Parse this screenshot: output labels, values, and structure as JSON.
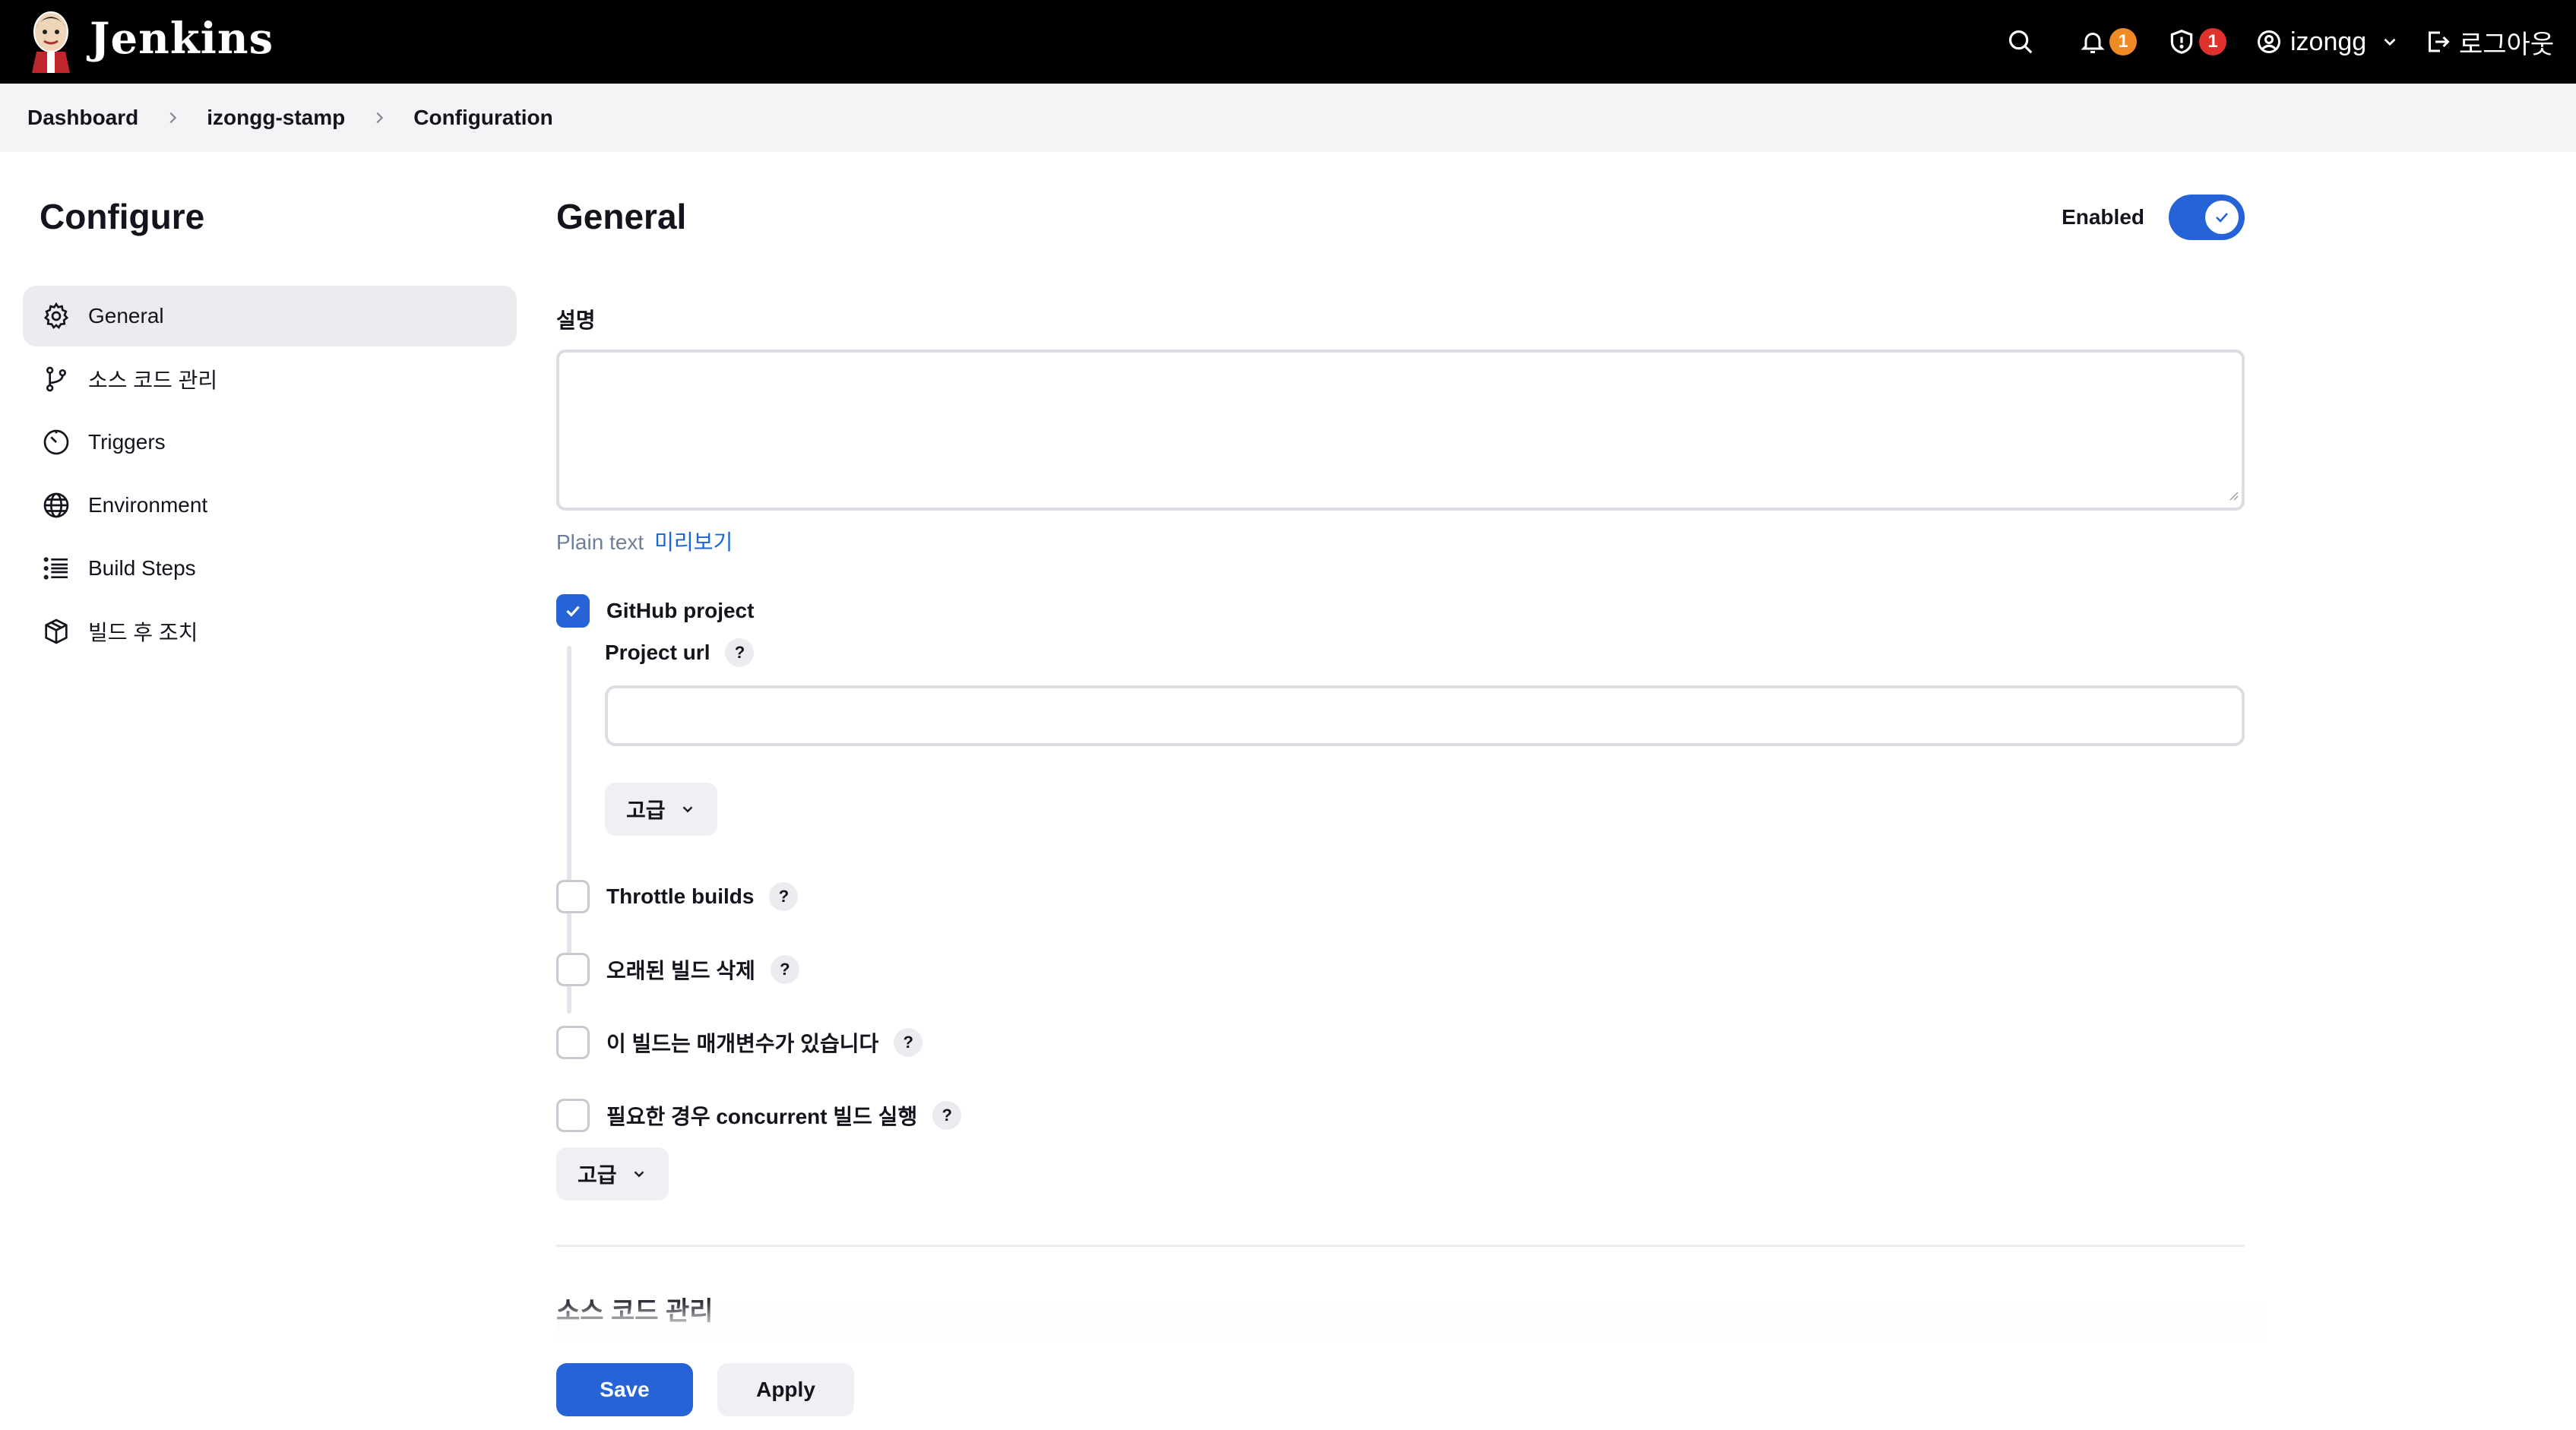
{
  "header": {
    "brand": "Jenkins",
    "notifications_count": "1",
    "security_count": "1",
    "username": "izongg",
    "logout_label": "로그아웃",
    "colors": {
      "background": "#000000",
      "notif_badge": "#f08a24",
      "security_badge": "#e0322d"
    }
  },
  "breadcrumb": {
    "items": [
      "Dashboard",
      "izongg-stamp",
      "Configuration"
    ]
  },
  "sidebar": {
    "title": "Configure",
    "items": [
      {
        "label": "General",
        "icon": "gear-icon",
        "active": true
      },
      {
        "label": "소스 코드 관리",
        "icon": "git-branch-icon"
      },
      {
        "label": "Triggers",
        "icon": "timer-icon"
      },
      {
        "label": "Environment",
        "icon": "globe-icon"
      },
      {
        "label": "Build Steps",
        "icon": "list-icon"
      },
      {
        "label": "빌드 후 조치",
        "icon": "package-icon"
      }
    ]
  },
  "general": {
    "title": "General",
    "enabled_label": "Enabled",
    "enabled": true,
    "description_label": "설명",
    "description_value": "",
    "plain_text": "Plain text",
    "preview": "미리보기",
    "github_project_label": "GitHub project",
    "github_project_checked": true,
    "project_url_label": "Project url",
    "project_url_value": "",
    "advanced_label": "고급",
    "options": [
      {
        "label": "Throttle builds",
        "checked": false
      },
      {
        "label": "오래된 빌드 삭제",
        "checked": false
      },
      {
        "label": "이 빌드는 매개변수가 있습니다",
        "checked": false
      },
      {
        "label": "필요한 경우 concurrent 빌드 실행",
        "checked": false
      }
    ],
    "help_symbol": "?"
  },
  "next_section_title": "소스 코드 관리",
  "actions": {
    "save_label": "Save",
    "apply_label": "Apply",
    "accent": "#2563d6"
  }
}
